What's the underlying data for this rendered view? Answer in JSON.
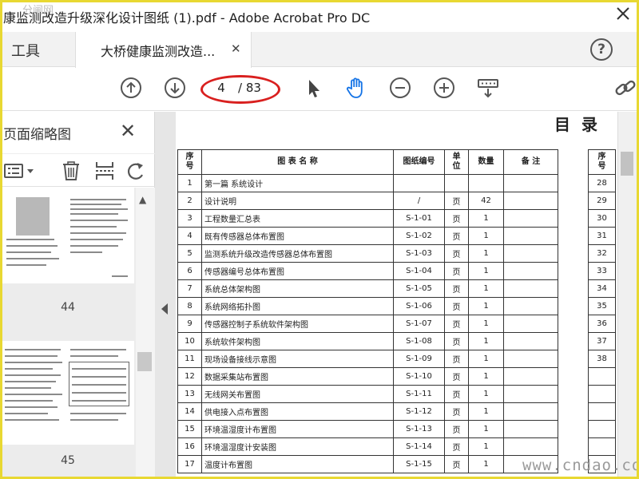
{
  "window": {
    "title": "康监测改造升级深化设计图纸 (1).pdf - Adobe Acrobat Pro DC",
    "top_watermark": "分闸网"
  },
  "tabs": {
    "tools_label": "工具",
    "document_label": "大桥健康监测改造..."
  },
  "toolbar": {
    "current_page": "4",
    "total_pages": "/ 83",
    "icons": [
      "arrow-up-circle-icon",
      "arrow-down-circle-icon",
      "select-cursor-icon",
      "hand-tool-icon",
      "zoom-out-icon",
      "zoom-in-icon",
      "keyboard-input-icon",
      "link-icon"
    ],
    "highlight_color": "#d9201f",
    "accent_color": "#1473e6"
  },
  "sidebar": {
    "title": "页面缩略图",
    "thumbnails": [
      {
        "page_label": "44"
      },
      {
        "page_label": "45"
      }
    ]
  },
  "document": {
    "heading": "目录",
    "headers": [
      "序\n号",
      "图  表  名  称",
      "图纸编号",
      "单\n位",
      "数量",
      "备  注"
    ],
    "rows": [
      [
        "1",
        "第一篇  系统设计",
        "",
        "",
        "",
        ""
      ],
      [
        "2",
        "设计说明",
        "/",
        "页",
        "42",
        ""
      ],
      [
        "3",
        "工程数量汇总表",
        "S-1-01",
        "页",
        "1",
        ""
      ],
      [
        "4",
        "既有传感器总体布置图",
        "S-1-02",
        "页",
        "1",
        ""
      ],
      [
        "5",
        "监测系统升级改造传感器总体布置图",
        "S-1-03",
        "页",
        "1",
        ""
      ],
      [
        "6",
        "传感器编号总体布置图",
        "S-1-04",
        "页",
        "1",
        ""
      ],
      [
        "7",
        "系统总体架构图",
        "S-1-05",
        "页",
        "1",
        ""
      ],
      [
        "8",
        "系统网络拓扑图",
        "S-1-06",
        "页",
        "1",
        ""
      ],
      [
        "9",
        "传感器控制子系统软件架构图",
        "S-1-07",
        "页",
        "1",
        ""
      ],
      [
        "10",
        "系统软件架构图",
        "S-1-08",
        "页",
        "1",
        ""
      ],
      [
        "11",
        "现场设备接线示意图",
        "S-1-09",
        "页",
        "1",
        ""
      ],
      [
        "12",
        "数据采集站布置图",
        "S-1-10",
        "页",
        "1",
        ""
      ],
      [
        "13",
        "无线网关布置图",
        "S-1-11",
        "页",
        "1",
        ""
      ],
      [
        "14",
        "供电接入点布置图",
        "S-1-12",
        "页",
        "1",
        ""
      ],
      [
        "15",
        "环境温湿度计布置图",
        "S-1-13",
        "页",
        "1",
        ""
      ],
      [
        "16",
        "环境温湿度计安装图",
        "S-1-14",
        "页",
        "1",
        ""
      ],
      [
        "17",
        "温度计布置图",
        "S-1-15",
        "页",
        "1",
        ""
      ]
    ],
    "right_header": "序\n号",
    "right_numbers": [
      "28",
      "29",
      "30",
      "31",
      "32",
      "33",
      "34",
      "35",
      "36",
      "37",
      "38",
      "",
      "",
      "",
      "",
      "",
      ""
    ]
  },
  "watermark": "www.cndao.com"
}
